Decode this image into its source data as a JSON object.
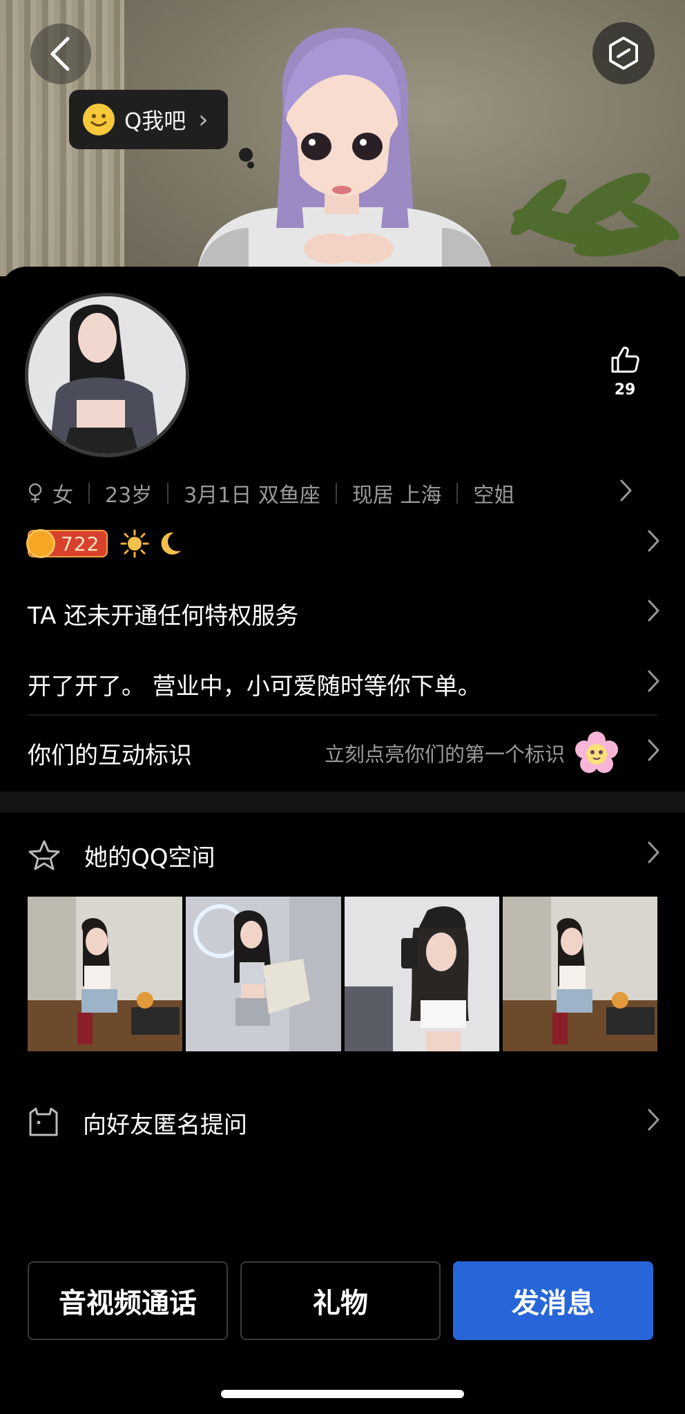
{
  "hero": {
    "bubble_label": "Q我吧"
  },
  "profile": {
    "like_count": "29",
    "info": {
      "gender": "女",
      "age": "23岁",
      "birthday": "3月1日 双鱼座",
      "residence": "现居 上海",
      "job": "空姐"
    },
    "level": "722"
  },
  "rows": {
    "privilege": "TA 还未开通任何特权服务",
    "signature": "开了开了。 营业中，小可爱随时等你下单。",
    "interact_label": "你们的互动标识",
    "interact_hint": "立刻点亮你们的第一个标识"
  },
  "qzone": {
    "title": "她的QQ空间"
  },
  "anonymous": {
    "label": "向好友匿名提问"
  },
  "actions": {
    "call": "音视频通话",
    "gift": "礼物",
    "message": "发消息"
  },
  "colors": {
    "primary_button": "#2766d8",
    "level_badge": "#d9412f",
    "background": "#000000"
  }
}
